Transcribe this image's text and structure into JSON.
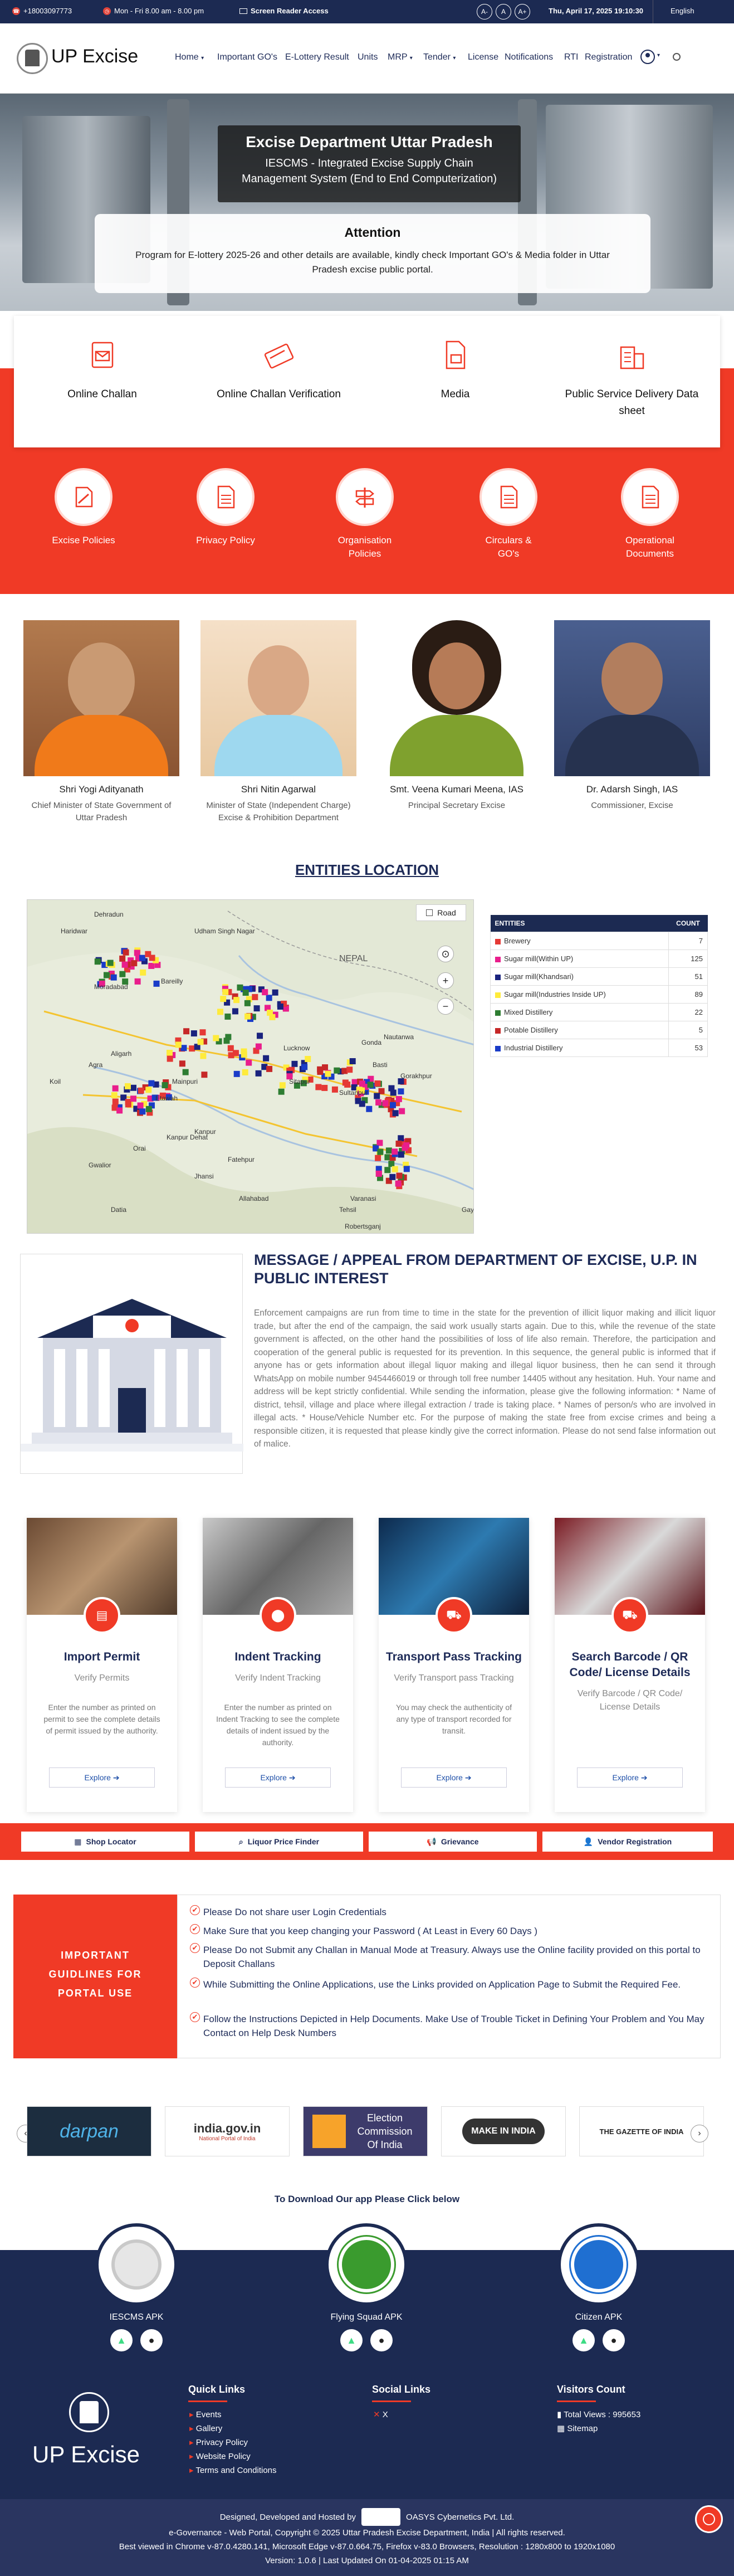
{
  "topbar": {
    "phone": "+18003097773",
    "hours": "Mon - Fri 8.00 am - 8.00 pm",
    "screen_reader": "Screen Reader Access",
    "font_minus": "A-",
    "font_normal": "A",
    "font_plus": "A+",
    "datetime": "Thu, April 17, 2025 19:10:30",
    "language": "English"
  },
  "header": {
    "brand": "UP Excise",
    "nav": [
      "Home",
      "Important GO's",
      "E-Lottery Result",
      "Units",
      "MRP",
      "Tender",
      "License",
      "Notifications",
      "RTI",
      "Registration"
    ],
    "nav_dropdowns": [
      "Home",
      "MRP",
      "Tender"
    ]
  },
  "hero": {
    "title": "Excise Department Uttar Pradesh",
    "subtitle": "IESCMS - Integrated Excise Supply Chain Management System (End to End Computerization)",
    "attention_title": "Attention",
    "attention_text": "Program for E-lottery 2025-26 and other details are available, kindly check Important GO's & Media folder in Uttar Pradesh excise public portal."
  },
  "services": [
    {
      "label": "Online Challan",
      "icon": "challan-icon"
    },
    {
      "label": "Online Challan Verification",
      "icon": "card-check-icon"
    },
    {
      "label": "Media",
      "icon": "media-file-icon"
    },
    {
      "label": "Public Service Delivery Data sheet",
      "icon": "building-icon"
    }
  ],
  "policies": [
    {
      "label": "Excise Policies",
      "icon": "pen-document-icon"
    },
    {
      "label": "Privacy Policy",
      "icon": "document-icon"
    },
    {
      "label": "Organisation Policies",
      "icon": "signpost-icon"
    },
    {
      "label": "Circulars & GO's",
      "icon": "document-icon"
    },
    {
      "label": "Operational Documents",
      "icon": "document-icon"
    }
  ],
  "officials": [
    {
      "name": "Shri Yogi Adityanath",
      "designation": "Chief Minister of State Government of Uttar Pradesh"
    },
    {
      "name": "Shri Nitin Agarwal",
      "designation": "Minister of State (Independent Charge) Excise & Prohibition Department"
    },
    {
      "name": "Smt. Veena Kumari Meena, IAS",
      "designation": "Principal Secretary Excise"
    },
    {
      "name": "Dr. Adarsh Singh, IAS",
      "designation": "Commissioner, Excise"
    }
  ],
  "entities": {
    "title": "ENTITIES LOCATION",
    "map_road_label": "Road",
    "map_places": [
      "Dehradun",
      "Haridwar",
      "Udham Singh Nagar",
      "Moradabad",
      "Bareilly",
      "Aligarh",
      "Koil",
      "Etawah",
      "Mainpuri",
      "Agra",
      "Kanpur",
      "Kanpur Dehat",
      "Orai",
      "Gwalior",
      "Fatehpur",
      "Allahabad",
      "Varanasi",
      "Lucknow",
      "Sultanpur",
      "Gorakhpur",
      "Nautanwa",
      "Basti",
      "Gonda",
      "Sitapur",
      "Jhansi",
      "NEPAL",
      "Tehsil",
      "Robertsganj",
      "Gaya",
      "Datia"
    ],
    "col_entities": "ENTITIES",
    "col_count": "COUNT",
    "rows": [
      {
        "name": "Brewery",
        "count": "7",
        "color": "#e53935"
      },
      {
        "name": "Sugar mill(Within UP)",
        "count": "125",
        "color": "#e91e8c"
      },
      {
        "name": "Sugar mill(Khandsari)",
        "count": "51",
        "color": "#1a237e"
      },
      {
        "name": "Sugar mill(Industries Inside UP)",
        "count": "89",
        "color": "#ffeb3b"
      },
      {
        "name": "Mixed Distillery",
        "count": "22",
        "color": "#2e7d32"
      },
      {
        "name": "Potable Distillery",
        "count": "5",
        "color": "#c62828"
      },
      {
        "name": "Industrial Distillery",
        "count": "53",
        "color": "#1a3cc8"
      }
    ]
  },
  "message": {
    "title": "MESSAGE / APPEAL FROM DEPARTMENT OF EXCISE, U.P. IN PUBLIC INTEREST",
    "body": "Enforcement campaigns are run from time to time in the state for the prevention of illicit liquor making and illicit liquor trade, but after the end of the campaign, the said work usually starts again. Due to this, while the revenue of the state government is affected, on the other hand the possibilities of loss of life also remain. Therefore, the participation and cooperation of the general public is requested for its prevention. In this sequence, the general public is informed that if anyone has or gets information about illegal liquor making and illegal liquor business, then he can send it through WhatsApp on mobile number 9454466019 or through toll free number 14405 without any hesitation. Huh. Your name and address will be kept strictly confidential. While sending the information, please give the following information: * Name of district, tehsil, village and place where illegal extraction / trade is taking place. * Names of person/s who are involved in illegal acts. * House/Vehicle Number etc. For the purpose of making the state free from excise crimes and being a responsible citizen, it is requested that please kindly give the correct information. Please do not send false information out of malice."
  },
  "tracking": [
    {
      "title": "Import Permit",
      "sub": "Verify Permits",
      "desc": "Enter the number as printed on permit to see the complete details of permit issued by the authority.",
      "btn": "Explore",
      "icon": "permit-icon"
    },
    {
      "title": "Indent Tracking",
      "sub": "Verify Indent Tracking",
      "desc": "Enter the number as printed on Indent Tracking to see the complete details of indent issued by the authority.",
      "btn": "Explore",
      "icon": "location-pin-icon"
    },
    {
      "title": "Transport Pass Tracking",
      "sub": "Verify Transport pass Tracking",
      "desc": "You may check the authenticity of any type of transport recorded for transit.",
      "btn": "Explore",
      "icon": "truck-icon"
    },
    {
      "title": "Search Barcode / QR Code/ License Details",
      "sub": "Verify Barcode / QR Code/ License Details",
      "desc": "",
      "btn": "Explore",
      "icon": "truck-icon"
    }
  ],
  "quick_buttons": [
    {
      "label": "Shop Locator",
      "icon": "shop-icon"
    },
    {
      "label": "Liquor Price Finder",
      "icon": "search-icon"
    },
    {
      "label": "Grievance",
      "icon": "megaphone-icon"
    },
    {
      "label": "Vendor Registration",
      "icon": "user-icon"
    }
  ],
  "guidelines": {
    "title": "IMPORTANT GUIDLINES FOR PORTAL USE",
    "items": [
      "Please Do not share user Login Credentials",
      "Make Sure that you keep changing your Password ( At Least in Every 60 Days )",
      "Please Do not Submit any Challan in Manual Mode at Treasury. Always use the Online facility provided on this portal to Deposit Challans",
      "While Submitting the Online Applications, use the Links provided on Application Page to Submit the Required Fee.",
      "Follow the Instructions Depicted in Help Documents. Make Use of Trouble Ticket in Defining Your Problem and You May Contact on Help Desk Numbers"
    ]
  },
  "partner_logos": [
    {
      "label": "darpan"
    },
    {
      "label": "india.gov.in",
      "sub": "National Portal of India"
    },
    {
      "label": "Election Commission Of India"
    },
    {
      "label": "MAKE IN INDIA"
    },
    {
      "label": "THE GAZETTE OF INDIA"
    }
  ],
  "apps": {
    "title": "To Download Our app Please Click below",
    "items": [
      {
        "name": "IESCMS APK"
      },
      {
        "name": "Flying Squad APK"
      },
      {
        "name": "Citizen APK"
      }
    ]
  },
  "footer": {
    "brand": "UP Excise",
    "quick_links_title": "Quick Links",
    "quick_links": [
      "Events",
      "Gallery",
      "Privacy Policy",
      "Website Policy",
      "Terms and Conditions"
    ],
    "social_title": "Social Links",
    "social": [
      "X"
    ],
    "visitors_title": "Visitors Count",
    "total_views": "Total Views : 995653",
    "sitemap": "Sitemap",
    "designed_by": "Designed, Developed and Hosted by",
    "oasys": "OASYS Cybernetics Pvt. Ltd.",
    "copyright": "e-Governance - Web Portal, Copyright © 2025 Uttar Pradesh Excise Department, India | All rights reserved.",
    "best_viewed": "Best viewed in Chrome v-87.0.4280.141, Microsoft Edge v-87.0.664.75, Firefox v-83.0 Browsers, Resolution : 1280x800 to 1920x1080",
    "version": "Version: 1.0.6 | Last Updated On 01-04-2025 01:15 AM"
  },
  "colors": {
    "navy": "#1c2a52",
    "red": "#f03a26"
  }
}
